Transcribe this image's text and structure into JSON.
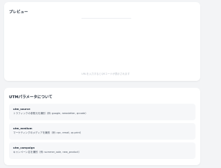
{
  "preview": {
    "title": "プレビュー",
    "placeholder": "URLを入力するとQRコードが表示されます"
  },
  "utm": {
    "title": "UTMパラメータについて",
    "params": [
      {
        "name": "utm_source",
        "description": "トラフィックの参照元を識別（例: google, newsletter, qrcode）"
      },
      {
        "name": "utm_medium",
        "description": "マーケティングのメディアを識別（例: cpc, email, qr-print）"
      },
      {
        "name": "utm_campaign",
        "description": "キャンペーン名を識別（例: summer_sale, new_product）"
      }
    ]
  }
}
